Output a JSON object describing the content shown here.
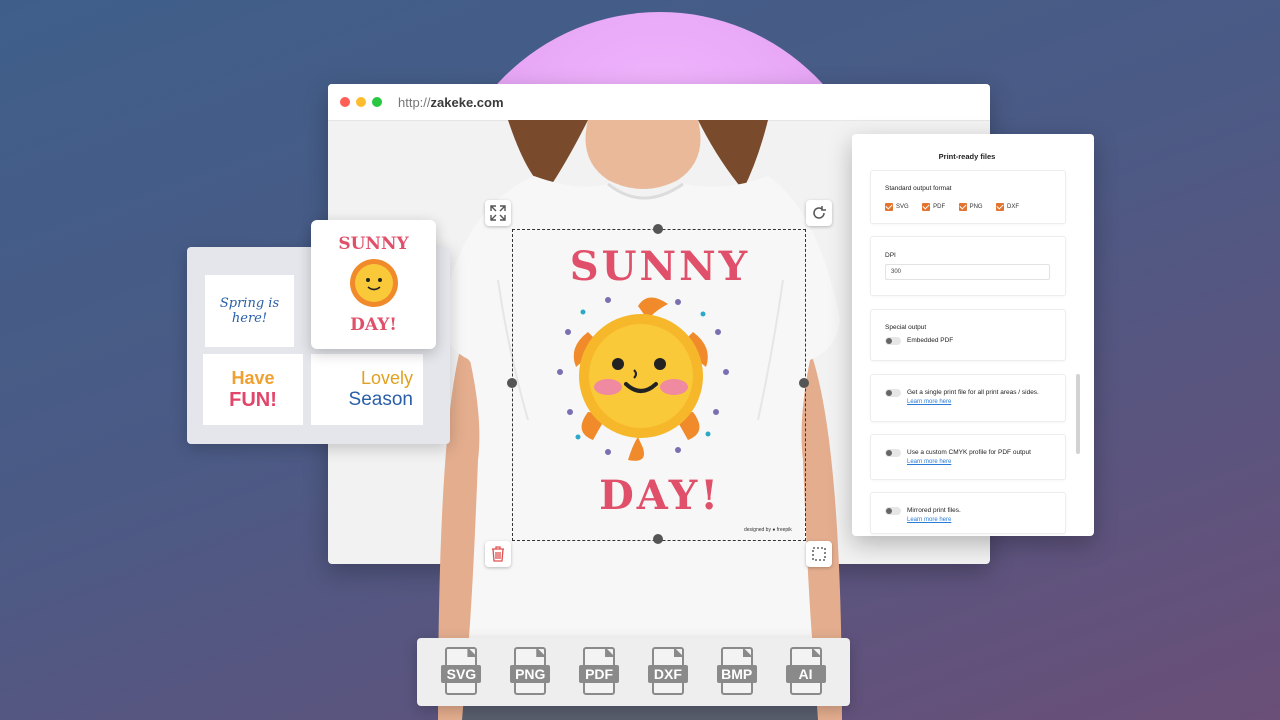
{
  "browser": {
    "url_protocol": "http://",
    "url_domain": "zakeke.com",
    "dot_colors": [
      "#ff5f57",
      "#febc2e",
      "#28c840"
    ]
  },
  "design": {
    "line1": "SUNNY",
    "line2": "DAY!",
    "credit": "designed by ● freepik"
  },
  "stickers": {
    "spring": "Spring is here!",
    "have": "Have",
    "fun": "FUN!",
    "lovely": "Lovely",
    "season": "Season",
    "card_line1": "SUNNY",
    "card_line2": "DAY!"
  },
  "panel": {
    "title": "Print-ready files",
    "output_label": "Standard output format",
    "formats": [
      "SVG",
      "PDF",
      "PNG",
      "DXF"
    ],
    "dpi_label": "DPI",
    "dpi_value": "300",
    "special_label": "Special output",
    "embedded_pdf": "Embedded PDF",
    "single_file": "Get a single print file for all print areas / sides.",
    "learn_more": "Learn more here",
    "cmyk": "Use a custom CMYK profile for PDF output",
    "mirrored": "Mirrored print files.",
    "learn_more_cut": "Learn more here"
  },
  "file_types": [
    "SVG",
    "PNG",
    "PDF",
    "DXF",
    "BMP",
    "AI"
  ],
  "colors": {
    "accent_orange": "#e3742f",
    "design_pink": "#e0506a",
    "link_blue": "#2a7bd8"
  }
}
